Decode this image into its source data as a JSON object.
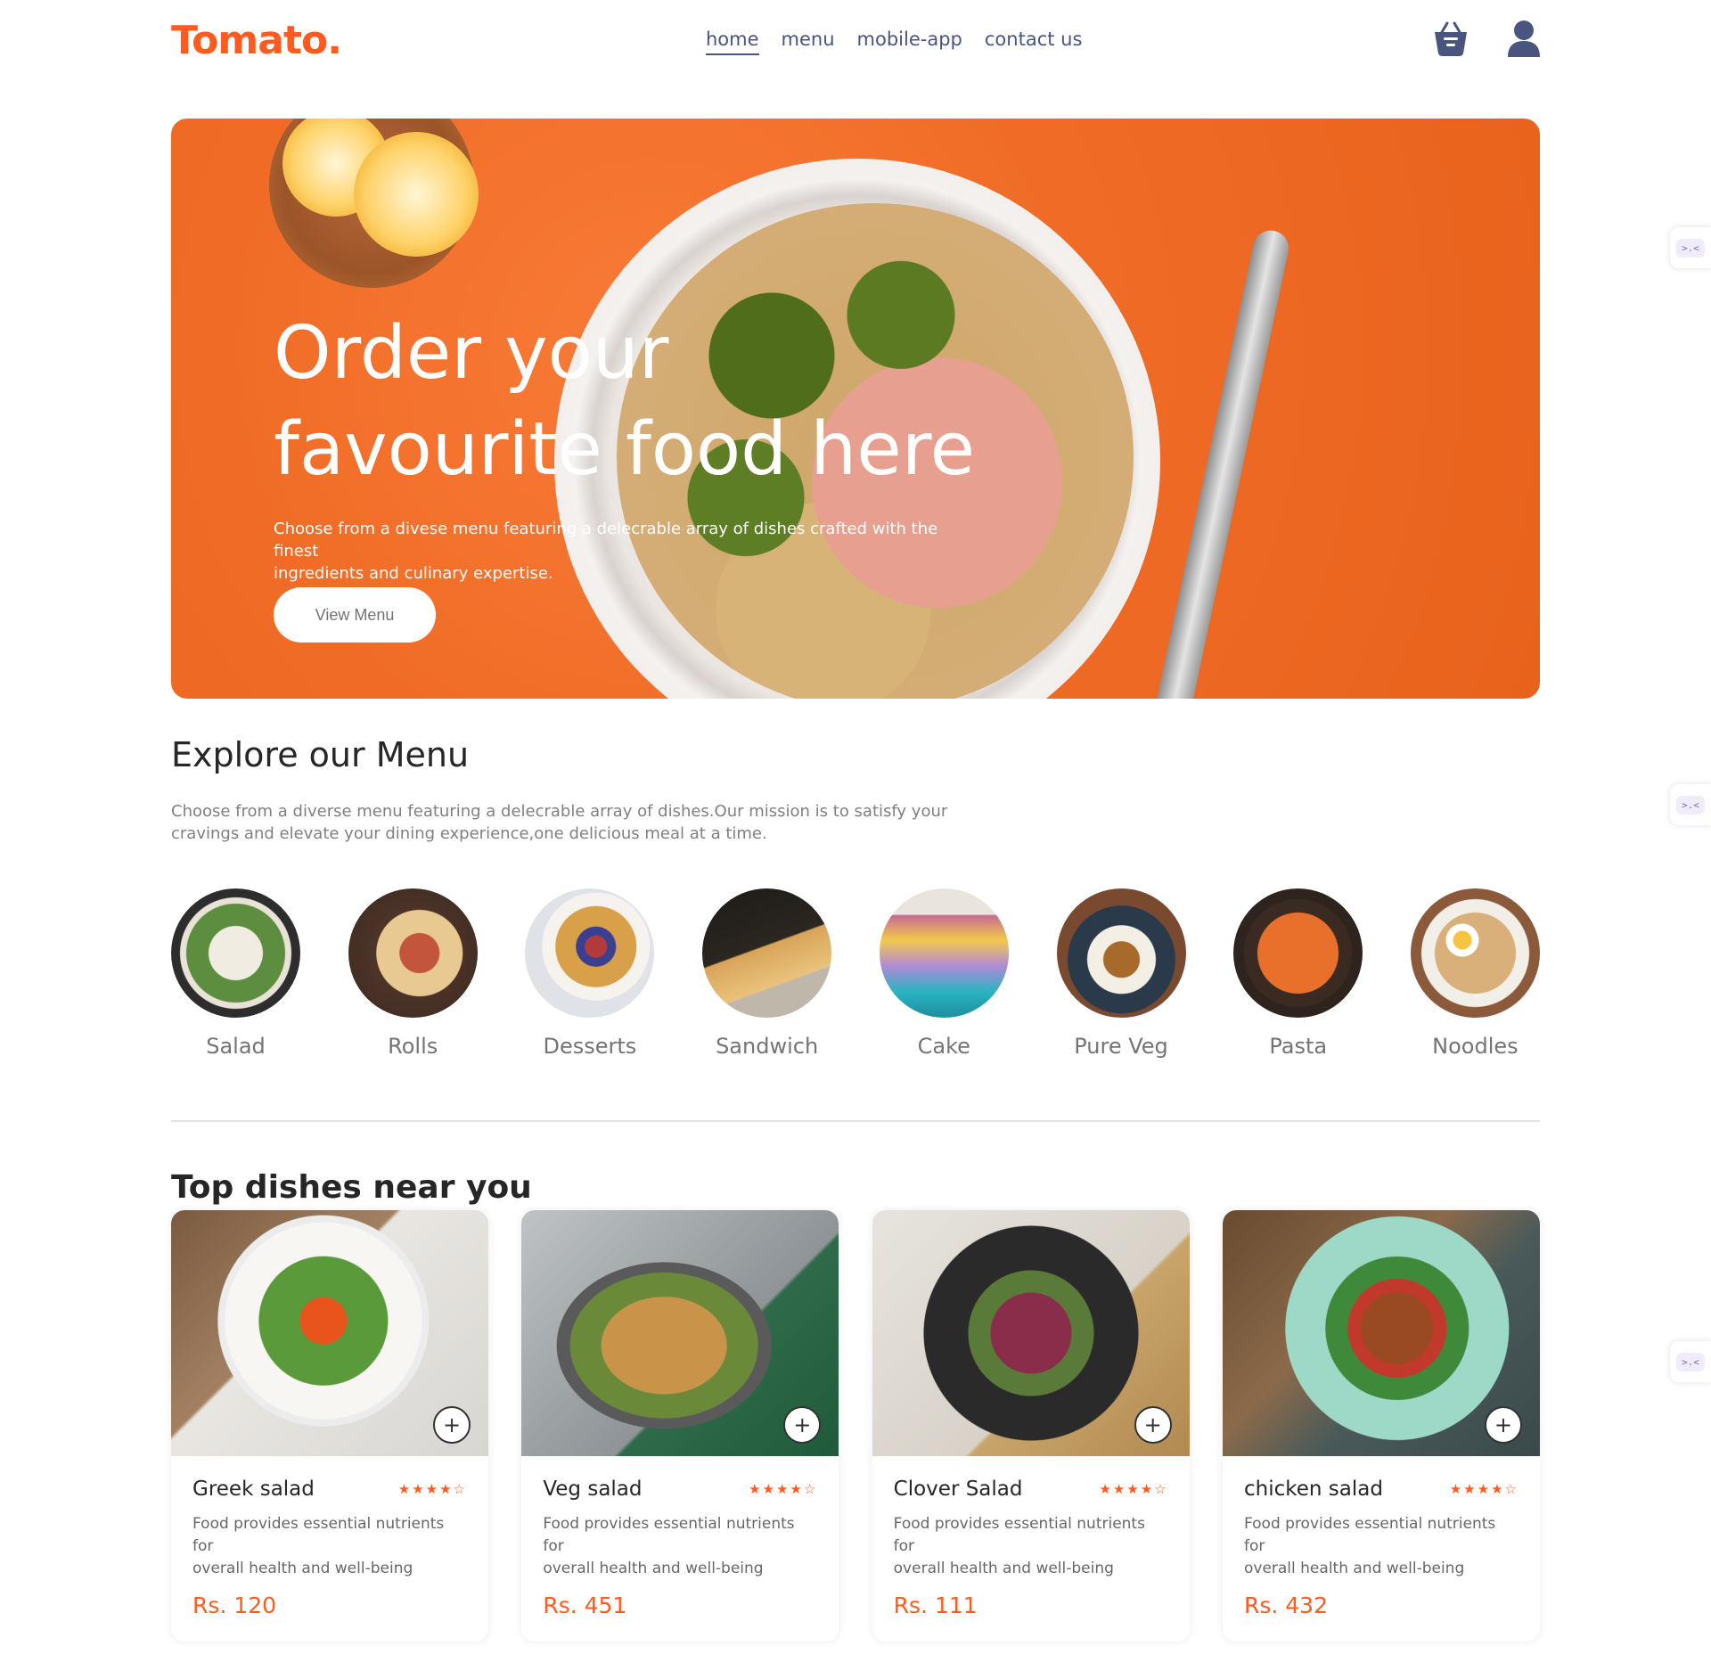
{
  "navbar": {
    "logo": "Tomato.",
    "links": [
      "home",
      "menu",
      "mobile-app",
      "contact us"
    ],
    "active_link": "home",
    "basket_icon": "basket-icon",
    "profile_icon": "profile-icon"
  },
  "hero": {
    "title_line1": "Order your",
    "title_line2": "favourite food here",
    "description_line1": "Choose from a divese menu featuring a delecrable array of dishes crafted with the finest",
    "description_line2": "ingredients and culinary expertise.",
    "button_label": "View Menu"
  },
  "explore": {
    "title": "Explore our Menu",
    "description_line1": "Choose from a diverse menu featuring a delecrable array of dishes.Our mission is to satisfy your",
    "description_line2": "cravings and elevate your dining experience,one delicious meal at a time.",
    "categories": [
      "Salad",
      "Rolls",
      "Desserts",
      "Sandwich",
      "Cake",
      "Pure Veg",
      "Pasta",
      "Noodles"
    ]
  },
  "top_dishes": {
    "title": "Top dishes near you",
    "items": [
      {
        "name": "Greek salad",
        "rating": 4,
        "description_line1": "Food provides essential nutrients for",
        "description_line2": "overall health and well-being",
        "price": "Rs. 120"
      },
      {
        "name": "Veg salad",
        "rating": 4,
        "description_line1": "Food provides essential nutrients for",
        "description_line2": "overall health and well-being",
        "price": "Rs. 451"
      },
      {
        "name": "Clover Salad",
        "rating": 4,
        "description_line1": "Food provides essential nutrients for",
        "description_line2": "overall health and well-being",
        "price": "Rs. 111"
      },
      {
        "name": "chicken salad",
        "rating": 4,
        "description_line1": "Food provides essential nutrients for",
        "description_line2": "overall health and well-being",
        "price": "Rs. 432"
      }
    ],
    "add_label": "+",
    "stars_text": "★★★★☆"
  },
  "side_widget_label": ">.<",
  "colors": {
    "brand": "#ff5b1f",
    "nav_text": "#49557e",
    "hero_bg": "#f06c26"
  }
}
